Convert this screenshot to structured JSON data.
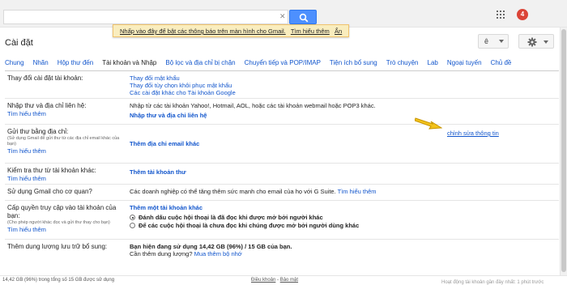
{
  "notice": {
    "text": "Nhấp vào đây để bật các thông báo trên màn hình cho Gmail.",
    "link1": "Tìm hiểu thêm",
    "link2": "Ẩn"
  },
  "topbar": {
    "search_clear": "✕",
    "badge": "4"
  },
  "page_title": "Cài đặt",
  "lang_button": "ê",
  "tabs": [
    "Chung",
    "Nhãn",
    "Hộp thư đến",
    "Tài khoản và Nhập",
    "Bộ lọc và địa chỉ bị chặn",
    "Chuyển tiếp và POP/IMAP",
    "Tiện ích bổ sung",
    "Trò chuyện",
    "Lab",
    "Ngoại tuyến",
    "Chủ đề"
  ],
  "rows": {
    "change_account": {
      "label": "Thay đổi cài đặt tài khoản:",
      "links": [
        "Thay đổi mật khẩu",
        "Thay đổi tùy chọn khôi phục mật khẩu",
        "Các cài đặt khác cho Tài khoản Google"
      ]
    },
    "import": {
      "label": "Nhập thư và địa chỉ liên hệ:",
      "help": "Tìm hiểu thêm",
      "text": "Nhập từ các tài khoản Yahoo!, Hotmail, AOL, hoặc các tài khoản webmail hoặc POP3 khác.",
      "action": "Nhập thư và địa chỉ liên hệ"
    },
    "send_as": {
      "label": "Gửi thư bằng địa chỉ:",
      "sub": "(Sử dụng Gmail để gửi thư từ các địa chỉ email khác của bạn)",
      "help": "Tìm hiểu thêm",
      "action": "Thêm địa chỉ email khác",
      "edit": "chỉnh sửa thông tin"
    },
    "check_mail": {
      "label": "Kiểm tra thư từ tài khoản khác:",
      "help": "Tìm hiểu thêm",
      "action": "Thêm tài khoản thư"
    },
    "work": {
      "label": "Sử dụng Gmail cho cơ quan?",
      "text": "Các doanh nghiệp có thể tăng thêm sức mạnh cho email của họ với G Suite.",
      "link": "Tìm hiểu thêm"
    },
    "grant": {
      "label": "Cấp quyền truy cập vào tài khoản của bạn:",
      "sub": "(Cho phép người khác đọc và gửi thư thay cho bạn)",
      "help": "Tìm hiểu thêm",
      "action": "Thêm một tài khoản khác",
      "option1": "Đánh dấu cuộc hội thoại là đã đọc khi được mở bởi người khác",
      "option2": "Để các cuộc hội thoại là chưa đọc khi chúng được mở bởi người dùng khác"
    },
    "storage": {
      "label": "Thêm dung lượng lưu trữ bổ sung:",
      "text": "Bạn hiện đang sử dụng 14,42 GB (96%) / 15 GB của bạn.",
      "q": "Cần thêm dung lượng?",
      "link": "Mua thêm bộ nhớ"
    }
  },
  "footer": {
    "storage": "14,42 GB (96%) trong tổng số 15 GB được sử dụng",
    "terms": "Điều khoản",
    "sep": " - ",
    "privacy": "Bảo mật",
    "activity": "Hoạt động tài khoản gần đây nhất: 1 phút trước"
  }
}
